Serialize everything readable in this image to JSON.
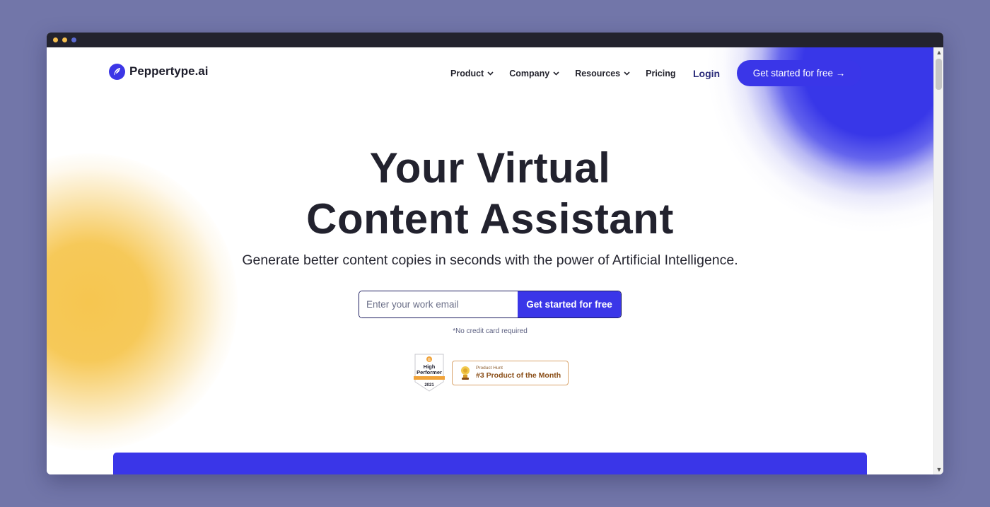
{
  "brand": {
    "name": "Peppertype.ai",
    "accent": "#3a36e8",
    "highlight": "#f6c650"
  },
  "nav": {
    "items": [
      {
        "label": "Product",
        "dropdown": true
      },
      {
        "label": "Company",
        "dropdown": true
      },
      {
        "label": "Resources",
        "dropdown": true
      },
      {
        "label": "Pricing",
        "dropdown": false
      }
    ],
    "login": "Login",
    "cta": "Get started for free →"
  },
  "hero": {
    "title_line1": "Your Virtual",
    "title_line2": "Content Assistant",
    "subtitle": "Generate better content copies in seconds with the power of Artificial Intelligence.",
    "email_placeholder": "Enter your work email",
    "email_value": "",
    "cta": "Get started for free",
    "note": "*No credit card required"
  },
  "badges": {
    "g2": {
      "line1": "High",
      "line2": "Performer",
      "year": "2021"
    },
    "product_hunt": {
      "label": "Product Hunt",
      "text": "#3 Product of the Month"
    }
  },
  "icons": {
    "logo": "feather-icon",
    "dropdown": "chevron-down-icon",
    "scroll_up": "caret-up-icon",
    "scroll_down": "caret-down-icon"
  }
}
